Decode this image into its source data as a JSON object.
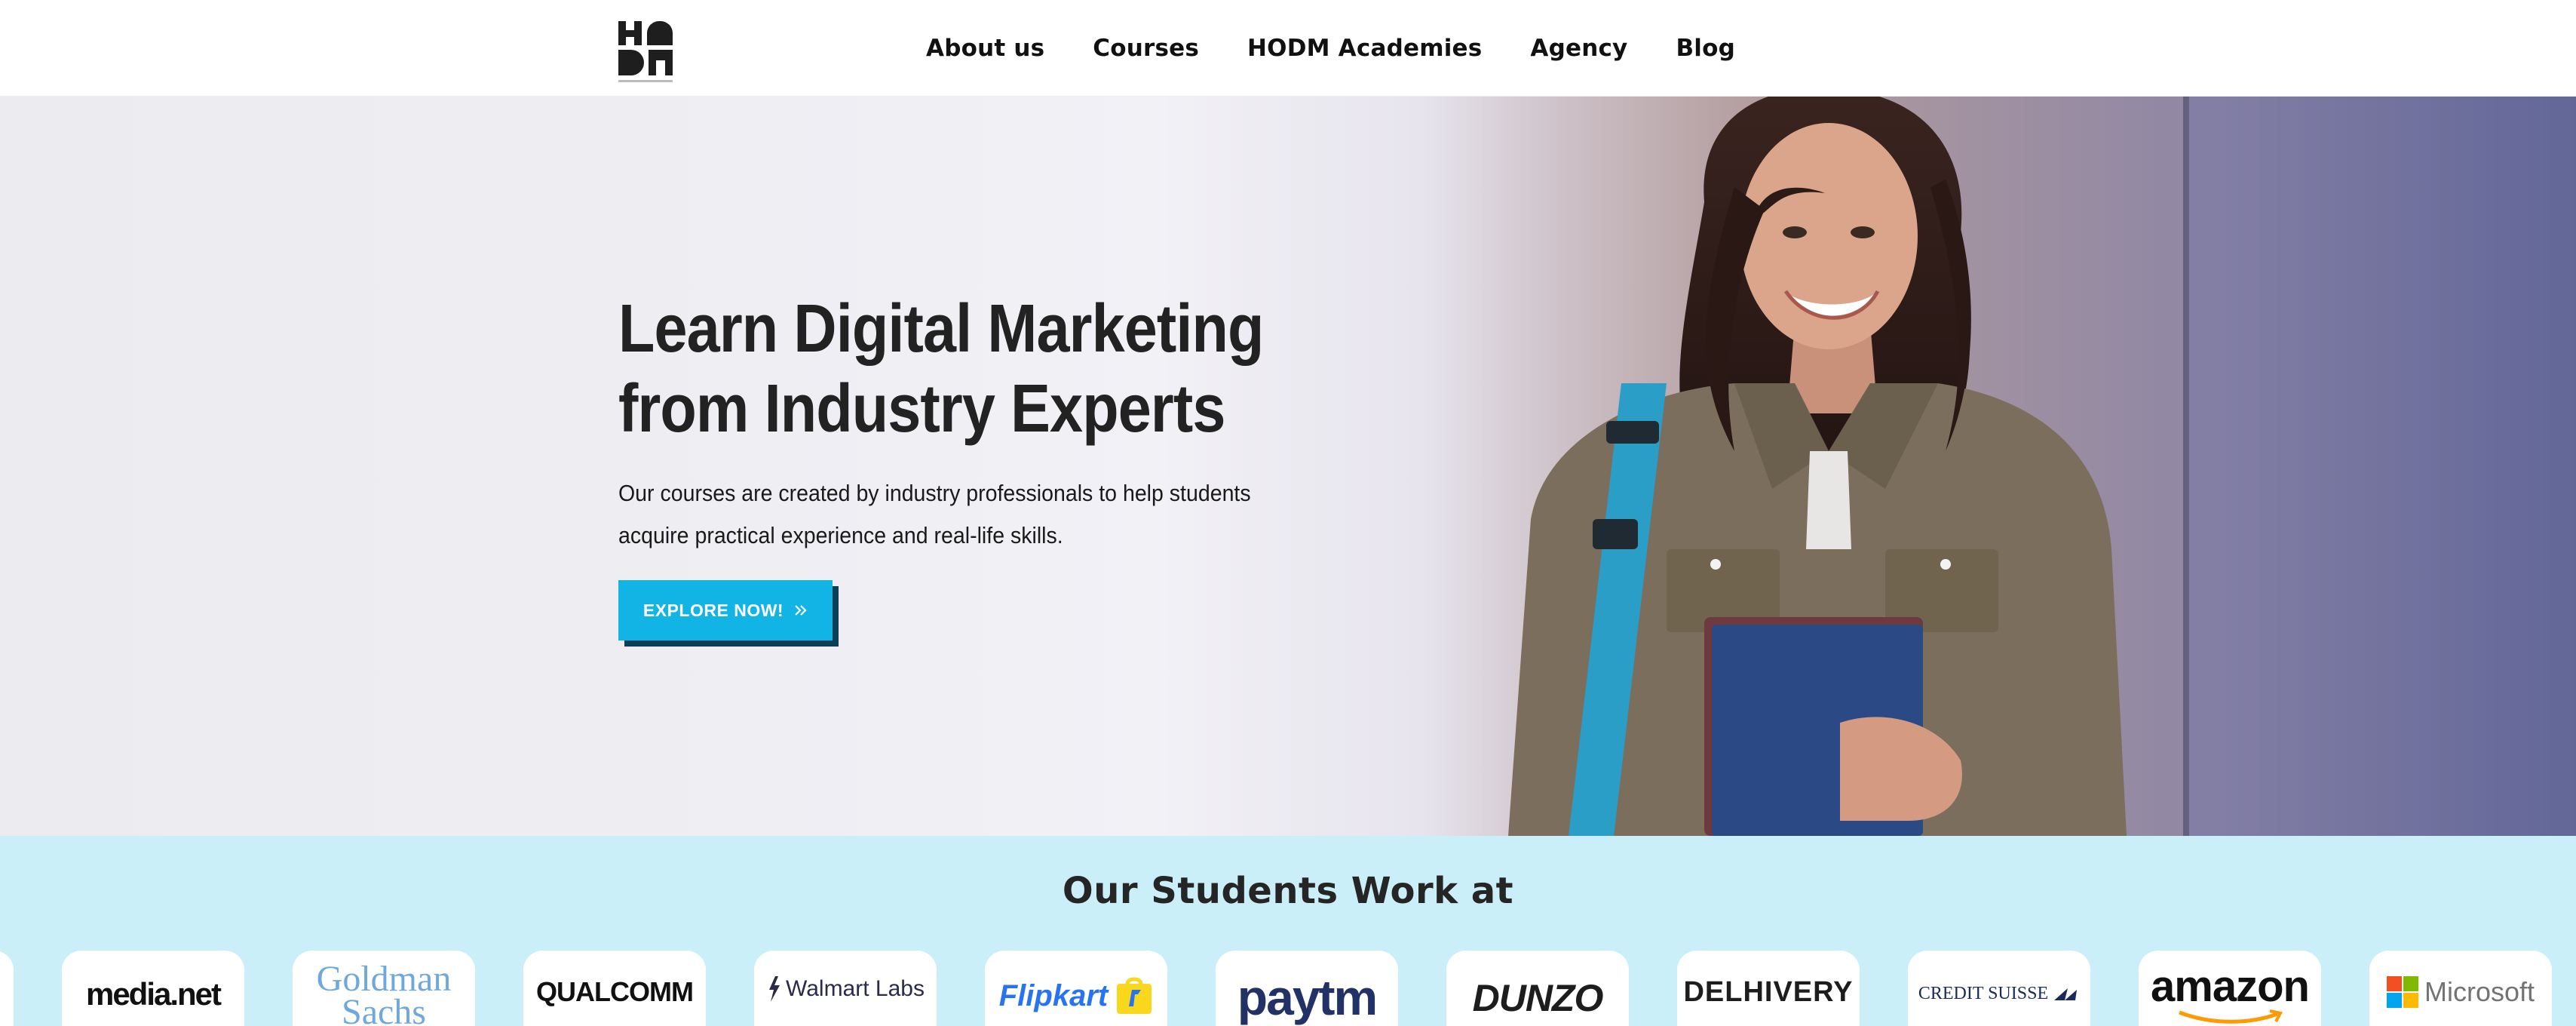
{
  "brand": {
    "logo_text": "HODM"
  },
  "nav": {
    "items": [
      "About us",
      "Courses",
      "HODM Academies",
      "Agency",
      "Blog"
    ]
  },
  "hero": {
    "title_line1": "Learn Digital Marketing",
    "title_line2": "from Industry Experts",
    "subtitle_line1": "Our courses are created by industry professionals to help students",
    "subtitle_line2": "acquire practical experience and real-life skills.",
    "cta_label": "EXPLORE NOW!",
    "cta_icon": "double-chevron-right-icon"
  },
  "students": {
    "heading": "Our Students Work at",
    "companies": [
      "media.net",
      "Goldman Sachs",
      "QUALCOMM",
      "Walmart Labs",
      "Flipkart",
      "paytm",
      "DUNZO",
      "DELHIVERY",
      "CREDIT SUISSE",
      "amazon",
      "Microsoft"
    ]
  },
  "colors": {
    "accent": "#12b4e6",
    "accent_shadow": "#0a3f57",
    "band_bg": "#cbeff9",
    "text_dark": "#222222"
  }
}
